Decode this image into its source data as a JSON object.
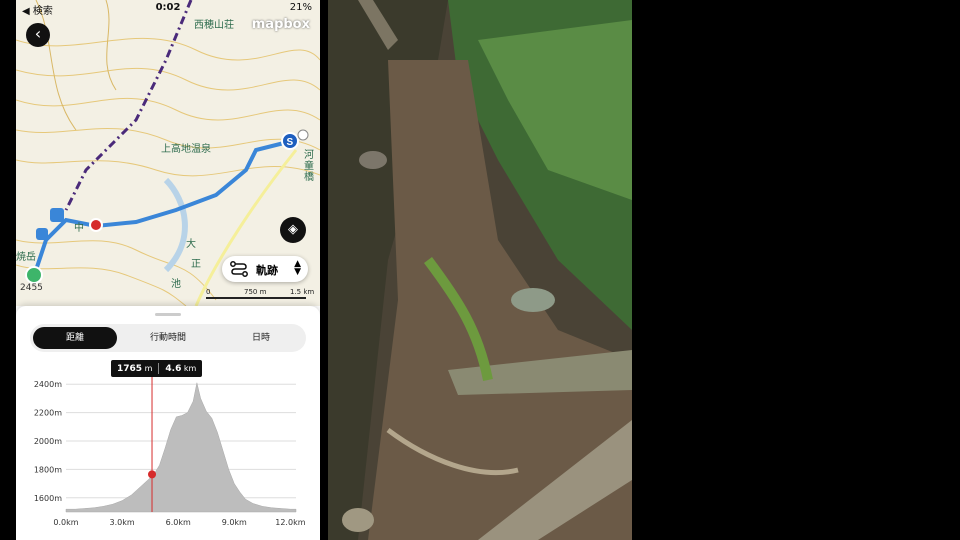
{
  "status_bar": {
    "left": "◀ 検索",
    "time": "0:02",
    "battery": "21%"
  },
  "map": {
    "labels": {
      "top_peak": "西穂山荘",
      "onsen": "上高地温泉",
      "river": "河童橋",
      "pond_1": "大",
      "pond_2": "正",
      "pond_3": "池",
      "side_1": "焼岳",
      "middle": "中"
    },
    "altitude_label": "2455",
    "attribution": "mapbox",
    "track_button_label": "軌跡",
    "scale_labels": [
      "0",
      "750 m",
      "1.5 km"
    ]
  },
  "tabs": [
    {
      "label": "距離",
      "active": true
    },
    {
      "label": "行動時間",
      "active": false
    },
    {
      "label": "日時",
      "active": false
    }
  ],
  "tooltip": {
    "elevation_value": "1765",
    "elevation_unit": "m",
    "distance_value": "4.6",
    "distance_unit": "km"
  },
  "chart_data": {
    "type": "area",
    "x": [
      0,
      0.5,
      1,
      1.5,
      2,
      2.5,
      3,
      3.5,
      4,
      4.5,
      4.7,
      5,
      5.3,
      5.6,
      5.9,
      6.2,
      6.5,
      6.8,
      7.0,
      7.2,
      7.5,
      7.8,
      8.1,
      8.4,
      8.7,
      9.0,
      9.3,
      9.6,
      10,
      10.5,
      11,
      11.5,
      12,
      12.3
    ],
    "y": [
      1520,
      1520,
      1525,
      1530,
      1540,
      1555,
      1580,
      1620,
      1680,
      1740,
      1765,
      1830,
      1950,
      2080,
      2170,
      2180,
      2200,
      2280,
      2410,
      2300,
      2210,
      2160,
      2060,
      1930,
      1800,
      1700,
      1640,
      1590,
      1560,
      1540,
      1530,
      1525,
      1520,
      1520
    ],
    "yticks": [
      "2400m",
      "2200m",
      "2000m",
      "1800m",
      "1600m"
    ],
    "ytick_values": [
      2400,
      2200,
      2000,
      1800,
      1600
    ],
    "xticks": [
      "0.0km",
      "3.0km",
      "6.0km",
      "9.0km",
      "12.0km"
    ],
    "xtick_values": [
      0,
      3,
      6,
      9,
      12
    ],
    "xlim": [
      0,
      12.3
    ],
    "ylim": [
      1500,
      2500
    ],
    "marker": {
      "x": 4.6,
      "y": 1765
    },
    "grid": true
  },
  "colors": {
    "track": "#3a86d8",
    "marker": "#d62b2b",
    "area": "#bdbdbd"
  }
}
